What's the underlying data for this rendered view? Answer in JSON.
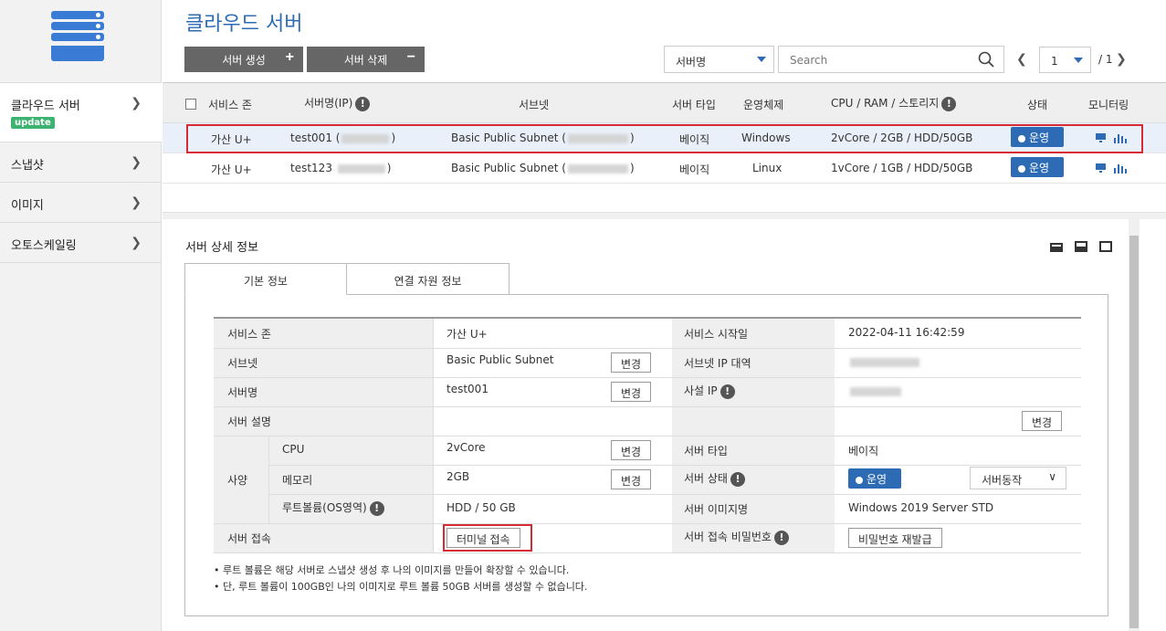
{
  "sidebar": {
    "items": [
      {
        "label": "클라우드 서버",
        "badge": "update"
      },
      {
        "label": "스냅샷"
      },
      {
        "label": "이미지"
      },
      {
        "label": "오토스케일링"
      }
    ]
  },
  "header": {
    "title": "클라우드 서버",
    "create_label": "서버 생성",
    "delete_label": "서버 삭제",
    "filter_value": "서버명",
    "search_placeholder": "Search",
    "page": "1",
    "page_total": "/ 1"
  },
  "table": {
    "headers": [
      "서비스 존",
      "서버명(IP)",
      "서브넷",
      "서버 타입",
      "운영체제",
      "CPU / RAM / 스토리지",
      "상태",
      "모니터링"
    ],
    "rows": [
      {
        "zone": "가산 U+",
        "name": "test001 (",
        "name_end": ")",
        "subnet": "Basic Public Subnet (",
        "subnet_end": ")",
        "type": "베이직",
        "os": "Windows",
        "spec": "2vCore / 2GB / HDD/50GB",
        "status": "운영"
      },
      {
        "zone": "가산 U+",
        "name": "test123",
        "name_end": ")",
        "subnet": "Basic Public Subnet (",
        "subnet_end": ")",
        "type": "베이직",
        "os": "Linux",
        "spec": "1vCore / 1GB / HDD/50GB",
        "status": "운영"
      }
    ]
  },
  "detail": {
    "title": "서버 상세 정보",
    "tabs": [
      "기본 정보",
      "연결 자원 정보"
    ],
    "labels": {
      "zone": "서비스 존",
      "subnet": "서브넷",
      "name": "서버명",
      "desc": "서버 설명",
      "spec": "사양",
      "cpu": "CPU",
      "mem": "메모리",
      "root": "루트볼륨(OS영역)",
      "access": "서버 접속",
      "start": "서비스 시작일",
      "subnet_ip": "서브넷 IP 대역",
      "private_ip": "사설 IP",
      "type": "서버 타입",
      "state": "서버 상태",
      "image": "서버 이미지명",
      "password": "서버 접속 비밀번호"
    },
    "values": {
      "zone": "가산 U+",
      "subnet": "Basic Public Subnet",
      "name": "test001",
      "cpu": "2vCore",
      "mem": "2GB",
      "root": "HDD / 50 GB",
      "start": "2022-04-11 16:42:59",
      "type": "베이직",
      "state": "운영",
      "image": "Windows 2019 Server STD",
      "action": "서버동작"
    },
    "buttons": {
      "change": "변경",
      "terminal": "터미널 접속",
      "reissue": "비밀번호 재발급"
    },
    "notes": [
      "• 루트 볼륨은 해당 서버로 스냅샷 생성 후 나의 이미지를 만들어 확장할 수 있습니다.",
      "• 단, 루트 볼륨이 100GB인 나의 이미지로 루트 볼륨 50GB 서버를 생성할 수 없습니다."
    ]
  },
  "colors": {
    "accent": "#2d6bb5",
    "highlight": "#d62b35",
    "badge": "#3cb371"
  }
}
